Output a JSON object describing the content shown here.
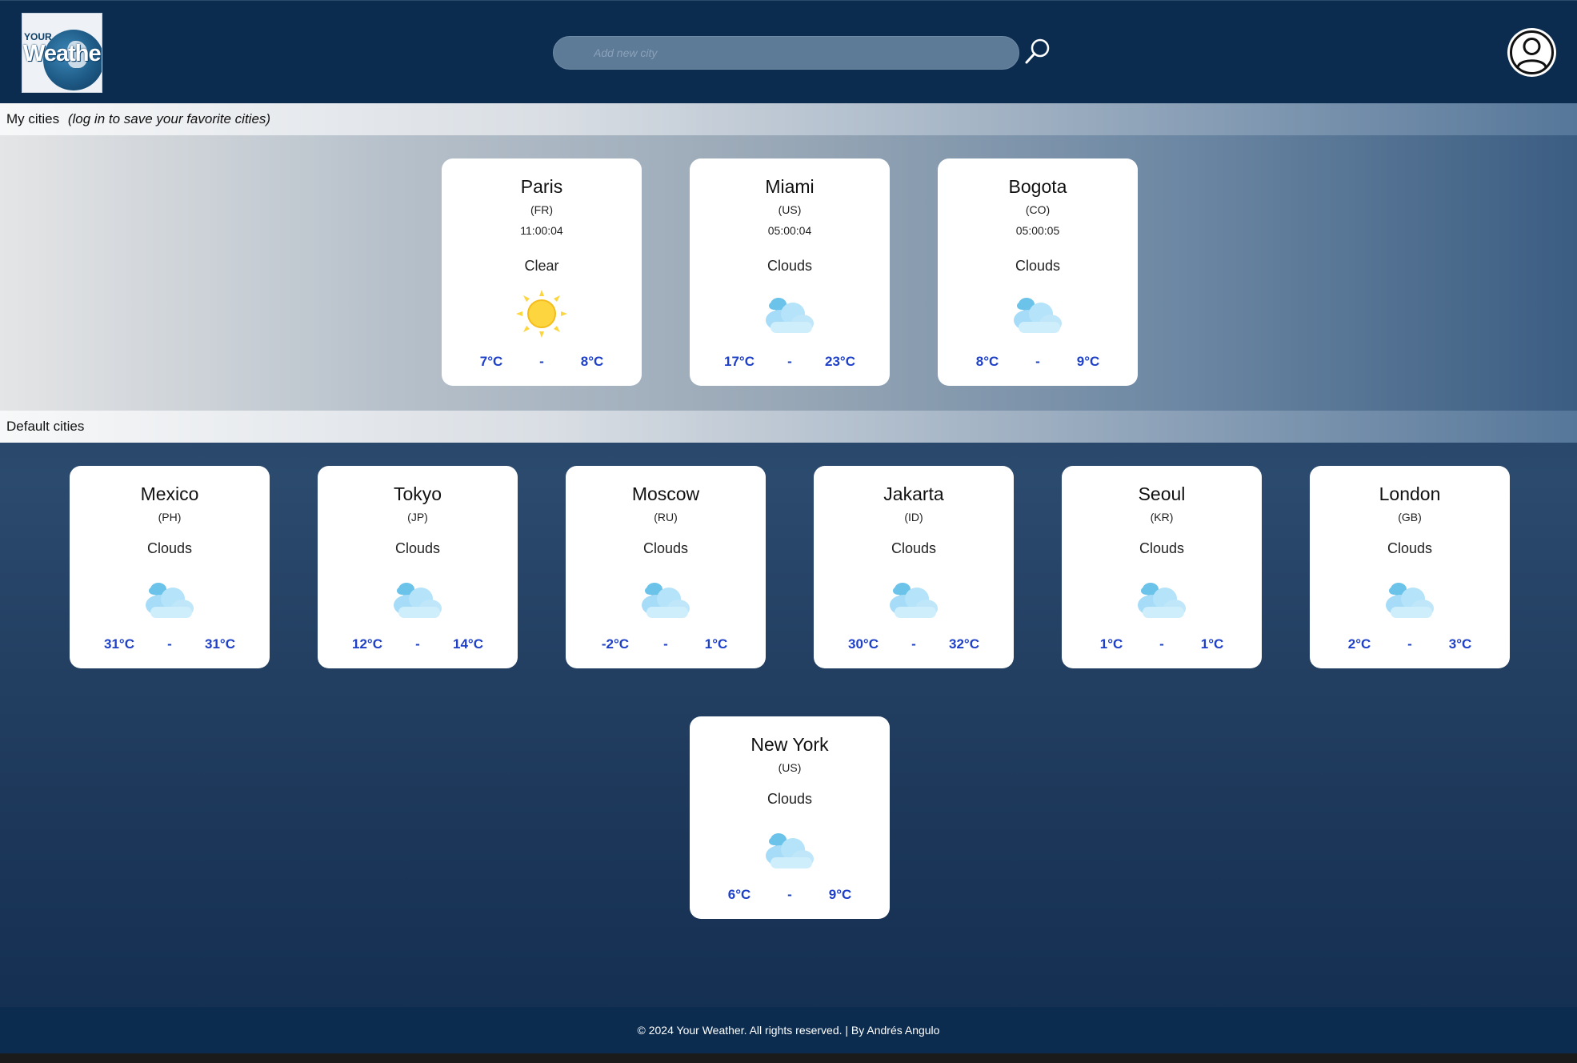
{
  "search": {
    "placeholder": "Add new city"
  },
  "logo": {
    "line1": "YOUR",
    "line2": "Weather"
  },
  "sections": {
    "my_cities": {
      "label": "My cities",
      "note": "(log in to save your favorite cities)"
    },
    "default_cities": {
      "label": "Default cities"
    }
  },
  "my_cities": [
    {
      "city": "Paris",
      "country": "(FR)",
      "time": "11:00:04",
      "condition": "Clear",
      "icon": "sun-icon",
      "min": "7°C",
      "sep": "-",
      "max": "8°C"
    },
    {
      "city": "Miami",
      "country": "(US)",
      "time": "05:00:04",
      "condition": "Clouds",
      "icon": "cloud-icon",
      "min": "17°C",
      "sep": "-",
      "max": "23°C"
    },
    {
      "city": "Bogota",
      "country": "(CO)",
      "time": "05:00:05",
      "condition": "Clouds",
      "icon": "cloud-icon",
      "min": "8°C",
      "sep": "-",
      "max": "9°C"
    }
  ],
  "default_cities": [
    {
      "city": "Mexico",
      "country": "(PH)",
      "condition": "Clouds",
      "icon": "cloud-icon",
      "min": "31°C",
      "sep": "-",
      "max": "31°C"
    },
    {
      "city": "Tokyo",
      "country": "(JP)",
      "condition": "Clouds",
      "icon": "cloud-icon",
      "min": "12°C",
      "sep": "-",
      "max": "14°C"
    },
    {
      "city": "Moscow",
      "country": "(RU)",
      "condition": "Clouds",
      "icon": "cloud-icon",
      "min": "-2°C",
      "sep": "-",
      "max": "1°C"
    },
    {
      "city": "Jakarta",
      "country": "(ID)",
      "condition": "Clouds",
      "icon": "cloud-icon",
      "min": "30°C",
      "sep": "-",
      "max": "32°C"
    },
    {
      "city": "Seoul",
      "country": "(KR)",
      "condition": "Clouds",
      "icon": "cloud-icon",
      "min": "1°C",
      "sep": "-",
      "max": "1°C"
    },
    {
      "city": "London",
      "country": "(GB)",
      "condition": "Clouds",
      "icon": "cloud-icon",
      "min": "2°C",
      "sep": "-",
      "max": "3°C"
    },
    {
      "city": "New York",
      "country": "(US)",
      "condition": "Clouds",
      "icon": "cloud-icon",
      "min": "6°C",
      "sep": "-",
      "max": "9°C"
    }
  ],
  "footer": {
    "text": "© 2024 Your Weather. All rights reserved. | By Andrés Angulo"
  },
  "colors": {
    "header_bg": "#0b2c4f",
    "temp_text": "#1e40c8",
    "sun": "#fcd53f",
    "cloud": "#a6dcf7"
  }
}
